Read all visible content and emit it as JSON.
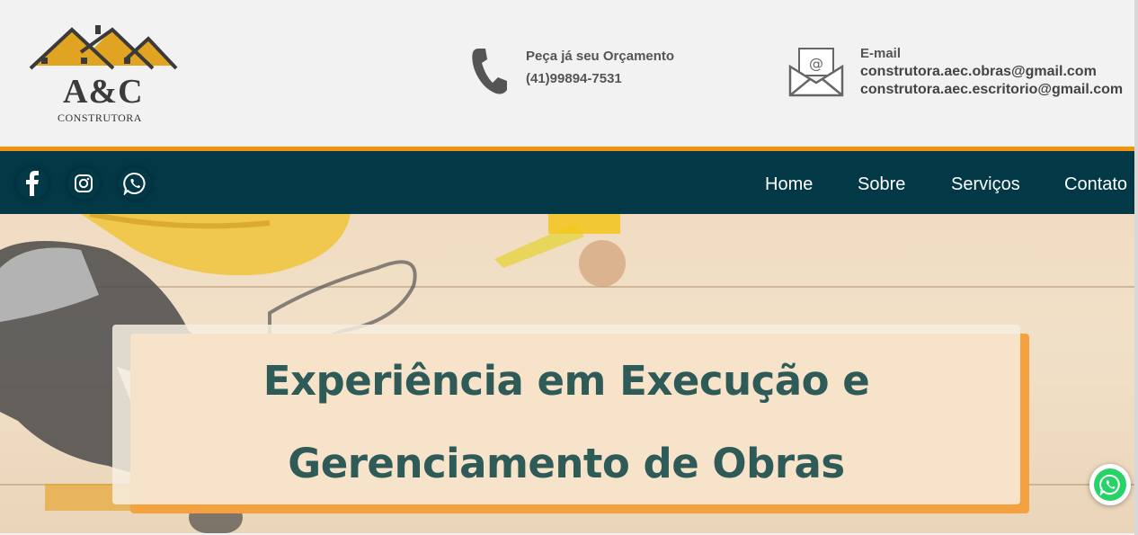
{
  "brand": {
    "logo_main": "A&C",
    "logo_sub": "CONSTRUTORA"
  },
  "contact": {
    "phone_label": "Peça já seu Orçamento",
    "phone_number": "(41)99894-7531",
    "email_label": "E-mail",
    "email_1": "construtora.aec.obras@gmail.com",
    "email_2": "construtora.aec.escritorio@gmail.com"
  },
  "social": [
    "facebook-icon",
    "instagram-icon",
    "whatsapp-icon"
  ],
  "nav": {
    "home": "Home",
    "about": "Sobre",
    "services": "Serviços",
    "contact": "Contato"
  },
  "hero": {
    "title_line1": "Experiência em Execução e",
    "title_line2": "Gerenciamento de Obras"
  },
  "colors": {
    "nav_bg": "#033846",
    "accent": "#f3940f",
    "hero_title": "#2e5a58",
    "whatsapp": "#25d366"
  }
}
